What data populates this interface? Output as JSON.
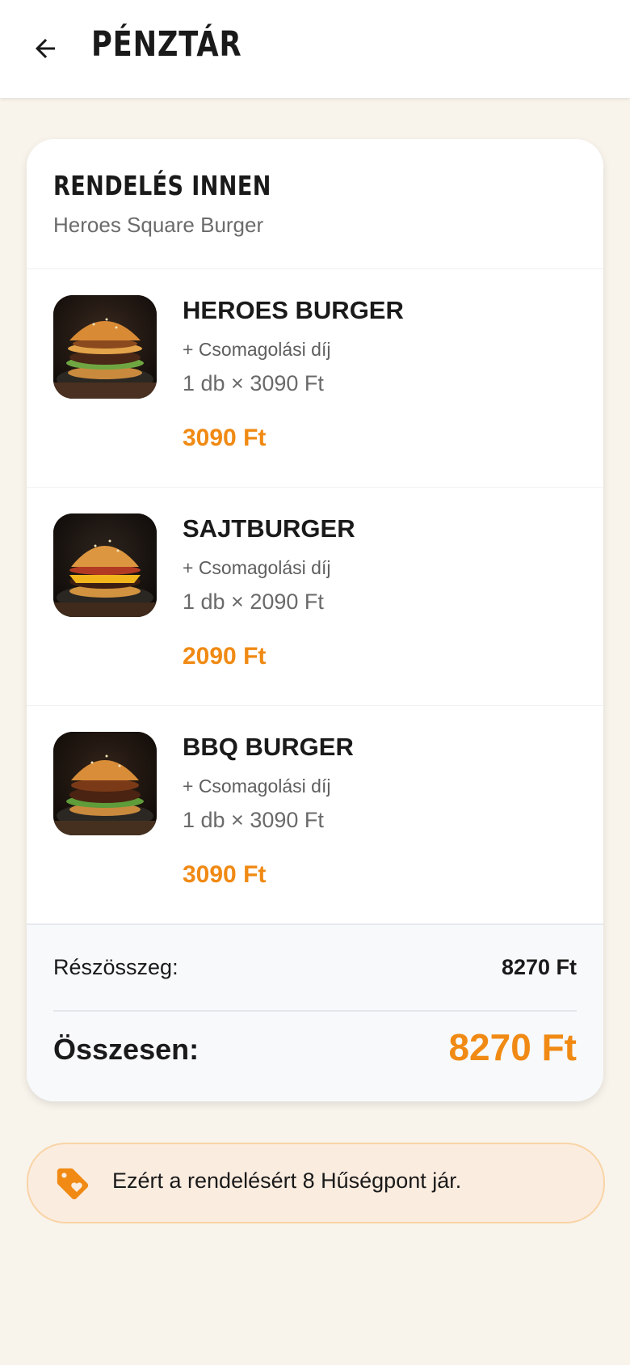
{
  "header": {
    "title": "PÉNZTÁR",
    "back_icon": "arrow-left-icon"
  },
  "restaurant": {
    "heading": "RENDELÉS INNEN",
    "name": "Heroes Square Burger"
  },
  "items": [
    {
      "name": "HEROES BURGER",
      "extra": "+ Csomagolási díj",
      "qty": "1 db × 3090 Ft",
      "price": "3090 Ft"
    },
    {
      "name": "SAJTBURGER",
      "extra": "+ Csomagolási díj",
      "qty": "1 db × 2090 Ft",
      "price": "2090 Ft"
    },
    {
      "name": "BBQ BURGER",
      "extra": "+ Csomagolási díj",
      "qty": "1 db × 3090 Ft",
      "price": "3090 Ft"
    }
  ],
  "totals": {
    "subtotal_label": "Részösszeg:",
    "subtotal_value": "8270 Ft",
    "total_label": "Összesen:",
    "total_value": "8270 Ft"
  },
  "loyalty": {
    "text": "Ezért a rendelésért 8 Hűségpont jár.",
    "icon": "tag-heart-icon"
  },
  "colors": {
    "accent": "#f08a14",
    "background": "#f8f4ec",
    "loyalty_bg": "#fbece0"
  }
}
